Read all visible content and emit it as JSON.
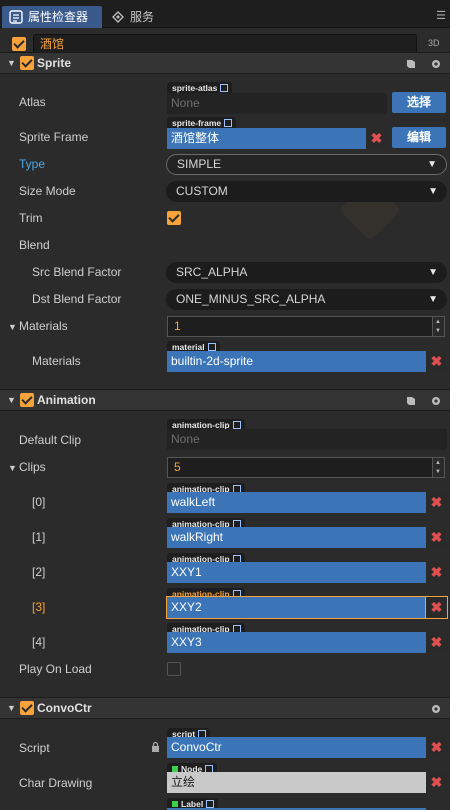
{
  "tabs": [
    {
      "label": "属性检查器",
      "icon": "inspector-icon",
      "active": true
    },
    {
      "label": "服务",
      "icon": "services-icon",
      "active": false
    }
  ],
  "node": {
    "name": "酒馆",
    "enabled": true,
    "mode_3d": "3D"
  },
  "components": {
    "sprite": {
      "title": "Sprite",
      "atlas": {
        "label": "Atlas",
        "tag": "sprite-atlas",
        "value": "None",
        "button": "选择"
      },
      "sprite_frame": {
        "label": "Sprite Frame",
        "tag": "sprite-frame",
        "value": "酒馆整体",
        "button": "编辑"
      },
      "type": {
        "label": "Type",
        "value": "SIMPLE"
      },
      "size_mode": {
        "label": "Size Mode",
        "value": "CUSTOM"
      },
      "trim": {
        "label": "Trim",
        "checked": true
      },
      "blend": {
        "label": "Blend"
      },
      "src_blend": {
        "label": "Src Blend Factor",
        "value": "SRC_ALPHA"
      },
      "dst_blend": {
        "label": "Dst Blend Factor",
        "value": "ONE_MINUS_SRC_ALPHA"
      },
      "materials_count": {
        "label": "Materials",
        "value": "1"
      },
      "materials_item": {
        "label": "Materials",
        "tag": "material",
        "value": "builtin-2d-sprite"
      }
    },
    "animation": {
      "title": "Animation",
      "default_clip": {
        "label": "Default Clip",
        "tag": "animation-clip",
        "value": "None"
      },
      "clips": {
        "label": "Clips",
        "count": "5"
      },
      "clip_items": [
        {
          "label": "[0]",
          "tag": "animation-clip",
          "value": "walkLeft"
        },
        {
          "label": "[1]",
          "tag": "animation-clip",
          "value": "walkRight"
        },
        {
          "label": "[2]",
          "tag": "animation-clip",
          "value": "XXY1"
        },
        {
          "label": "[3]",
          "tag": "animation-clip",
          "value": "XXY2"
        },
        {
          "label": "[4]",
          "tag": "animation-clip",
          "value": "XXY3"
        }
      ],
      "play_on_load": {
        "label": "Play On Load",
        "checked": false
      }
    },
    "convoctr": {
      "title": "ConvoCtr",
      "script": {
        "label": "Script",
        "tag": "script",
        "value": "ConvoCtr"
      },
      "char_drawing": {
        "label": "Char Drawing",
        "tag": "Node",
        "value": "立绘"
      },
      "next_tag": "Label"
    }
  },
  "colors": {
    "accent": "#f7a23a",
    "asset_blue": "#3b75b8",
    "label_blue": "#4aa7e8"
  }
}
